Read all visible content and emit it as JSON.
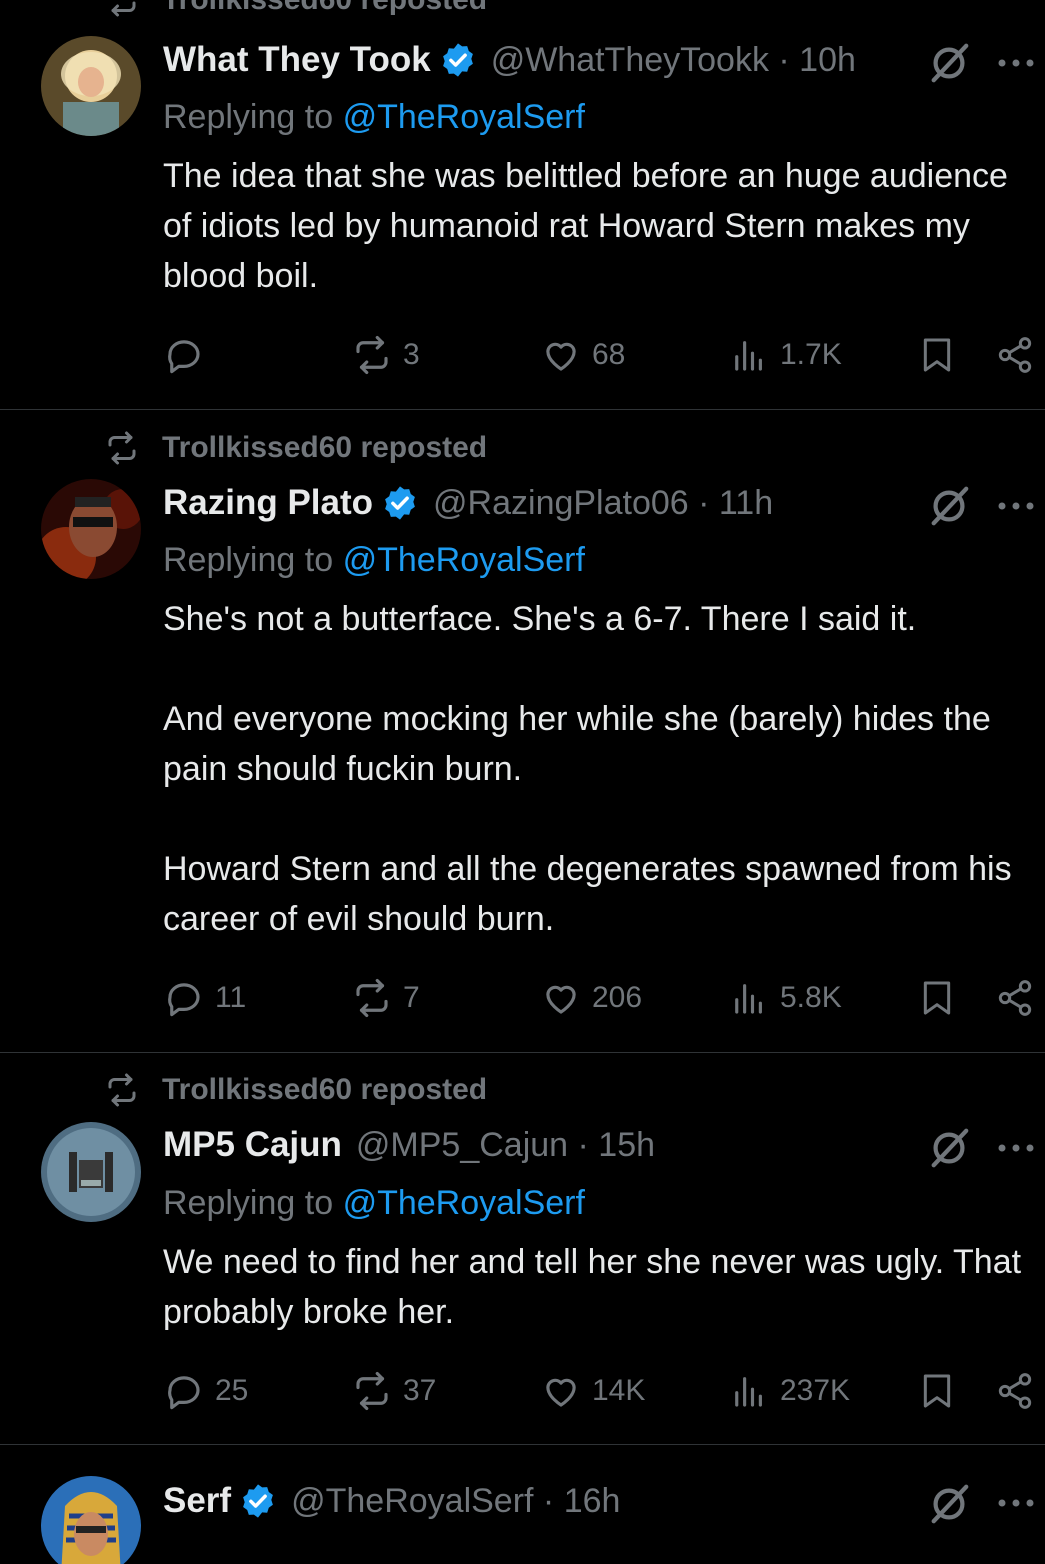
{
  "posts": [
    {
      "repost_by": "Trollkissed60 reposted",
      "display_name": "What They Took",
      "verified": true,
      "handle_meta": "@WhatTheyTookk · 10h",
      "reply_prefix": "Replying to",
      "reply_to": "@TheRoyalSerf",
      "paragraphs": [
        "The idea that she was belittled before an huge audience of idiots led by humanoid rat Howard Stern makes my blood boil."
      ],
      "replies": "",
      "reposts": "3",
      "likes": "68",
      "views": "1.7K"
    },
    {
      "repost_by": "Trollkissed60 reposted",
      "display_name": "Razing Plato",
      "verified": true,
      "handle_meta": "@RazingPlato06 · 11h",
      "reply_prefix": "Replying to",
      "reply_to": "@TheRoyalSerf",
      "paragraphs": [
        "She's not a butterface. She's a 6-7. There I said it.",
        "And everyone mocking her while she (barely) hides the pain should fuckin burn.",
        "Howard Stern and all the degenerates spawned from his career of evil should burn."
      ],
      "replies": "11",
      "reposts": "7",
      "likes": "206",
      "views": "5.8K"
    },
    {
      "repost_by": "Trollkissed60 reposted",
      "display_name": "MP5 Cajun",
      "verified": false,
      "handle_meta": "@MP5_Cajun · 15h",
      "reply_prefix": "Replying to",
      "reply_to": "@TheRoyalSerf",
      "paragraphs": [
        "We need to find her and tell her she never was ugly. That probably broke her."
      ],
      "replies": "25",
      "reposts": "37",
      "likes": "14K",
      "views": "237K"
    },
    {
      "display_name": "Serf",
      "verified": true,
      "handle_meta": "@TheRoyalSerf · 16h"
    }
  ],
  "colors": {
    "background": "#000000",
    "text_primary": "#e7e9ea",
    "text_secondary": "#71767b",
    "link": "#1d9bf0",
    "divider": "#2f3336"
  }
}
